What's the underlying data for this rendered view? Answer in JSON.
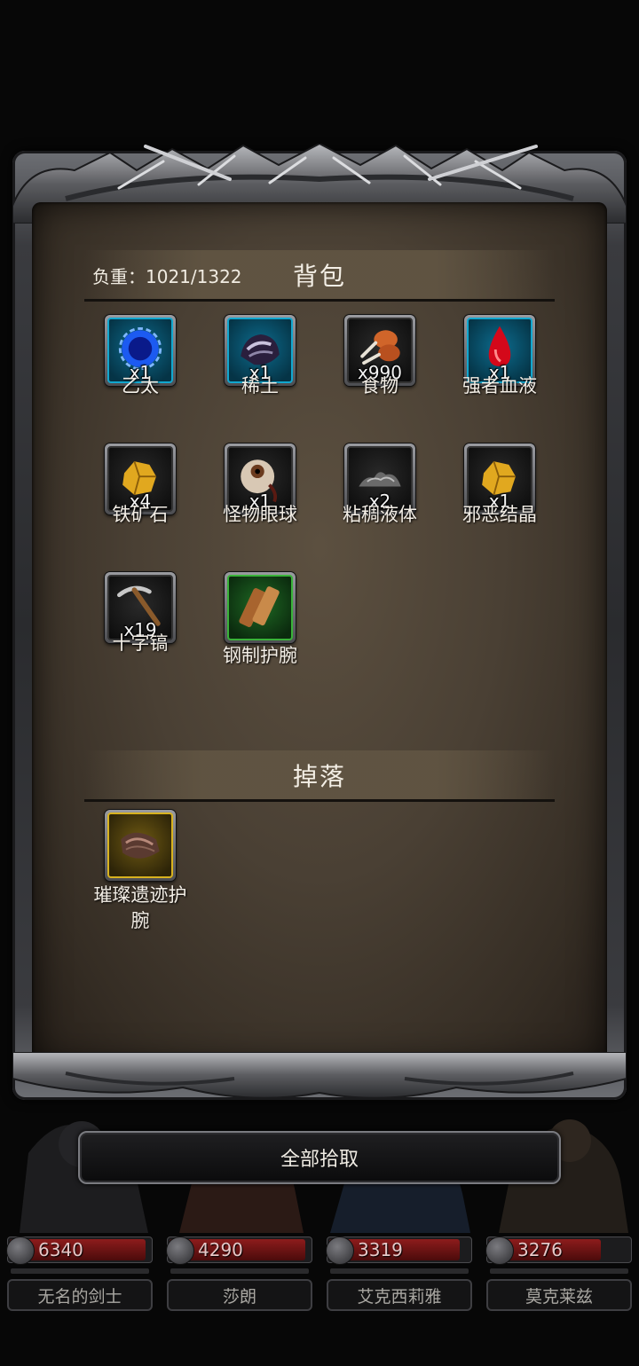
{
  "inventory": {
    "weight_label": "负重：1021/1322",
    "title": "背包",
    "items": [
      {
        "name": "乙太",
        "qty": "x1",
        "icon": "aether-orb-icon",
        "rarity": "blue"
      },
      {
        "name": "稀土",
        "qty": "x1",
        "icon": "rare-earth-icon",
        "rarity": "blue"
      },
      {
        "name": "食物",
        "qty": "x990",
        "icon": "meat-food-icon",
        "rarity": "plain"
      },
      {
        "name": "强者血液",
        "qty": "x1",
        "icon": "blood-drop-icon",
        "rarity": "blue"
      },
      {
        "name": "铁矿石",
        "qty": "x4",
        "icon": "iron-ore-icon",
        "rarity": "plain"
      },
      {
        "name": "怪物眼球",
        "qty": "x1",
        "icon": "monster-eyeball-icon",
        "rarity": "plain"
      },
      {
        "name": "粘稠液体",
        "qty": "x2",
        "icon": "viscous-liquid-icon",
        "rarity": "plain"
      },
      {
        "name": "邪恶结晶",
        "qty": "x1",
        "icon": "evil-crystal-icon",
        "rarity": "plain"
      },
      {
        "name": "十字镐",
        "qty": "x19",
        "icon": "pickaxe-icon",
        "rarity": "plain"
      },
      {
        "name": "钢制护腕",
        "qty": "",
        "icon": "steel-bracer-icon",
        "rarity": "green"
      }
    ]
  },
  "drops": {
    "title": "掉落",
    "items": [
      {
        "name": "璀璨遗迹护腕",
        "qty": "",
        "icon": "relic-bracer-icon",
        "rarity": "gold"
      }
    ]
  },
  "actions": {
    "pickup_all_label": "全部拾取"
  },
  "heroes": [
    {
      "name": "无名的剑士",
      "hp": "6340",
      "hp_fraction": 0.97
    },
    {
      "name": "莎朗",
      "hp": "4290",
      "hp_fraction": 0.97
    },
    {
      "name": "艾克西莉雅",
      "hp": "3319",
      "hp_fraction": 0.93
    },
    {
      "name": "莫克莱兹",
      "hp": "3276",
      "hp_fraction": 0.8
    }
  ],
  "colors": {
    "rarity_blue": "#11a7cf",
    "rarity_green": "#39b339",
    "rarity_gold": "#d8b21f",
    "hp_red": "#8d1c1c"
  }
}
